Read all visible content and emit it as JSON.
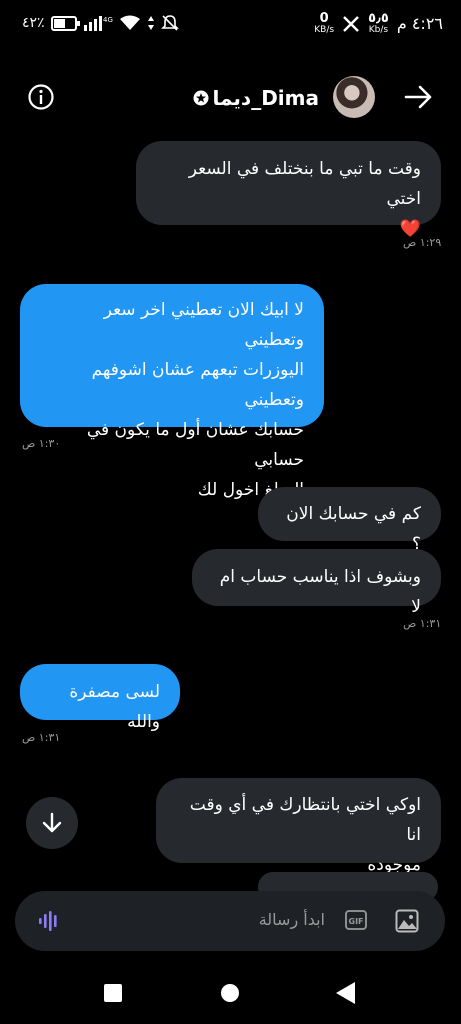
{
  "status_bar": {
    "time": "٤:٢٦ م",
    "net_speed_1": "٥٫٥",
    "net_speed_1_unit": "Kb/s",
    "net_speed_2": "0",
    "net_speed_2_unit": "KB/s",
    "network": "4G",
    "battery": "٤٢٪"
  },
  "header": {
    "contact_name": "ديما_Dima"
  },
  "messages": [
    {
      "text": "وقت ما تبي ما بنختلف في السعر اختي\n❤️",
      "time": "١:٢٩ ص"
    },
    {
      "text": "لا ابيك الان تعطيني اخر سعر وتعطيني\nاليوزرات تبعهم عشان اشوفهم وتعطيني\nحسابك عشان أول ما يكون في حسابي\nالمبلغ اخول لك",
      "time": "١:٣٠ ص"
    },
    {
      "text": "كم في حسابك الان ؟"
    },
    {
      "text": "وبشوف اذا يناسب حساب ام لا",
      "time": "١:٣١ ص"
    },
    {
      "text": "لسى مصفرة والله",
      "time": "١:٣١ ص"
    },
    {
      "text": "اوكي اختي بانتظارك في أي وقت انا\nموجوده"
    }
  ],
  "composer": {
    "placeholder": "ابدأ رسالة"
  }
}
